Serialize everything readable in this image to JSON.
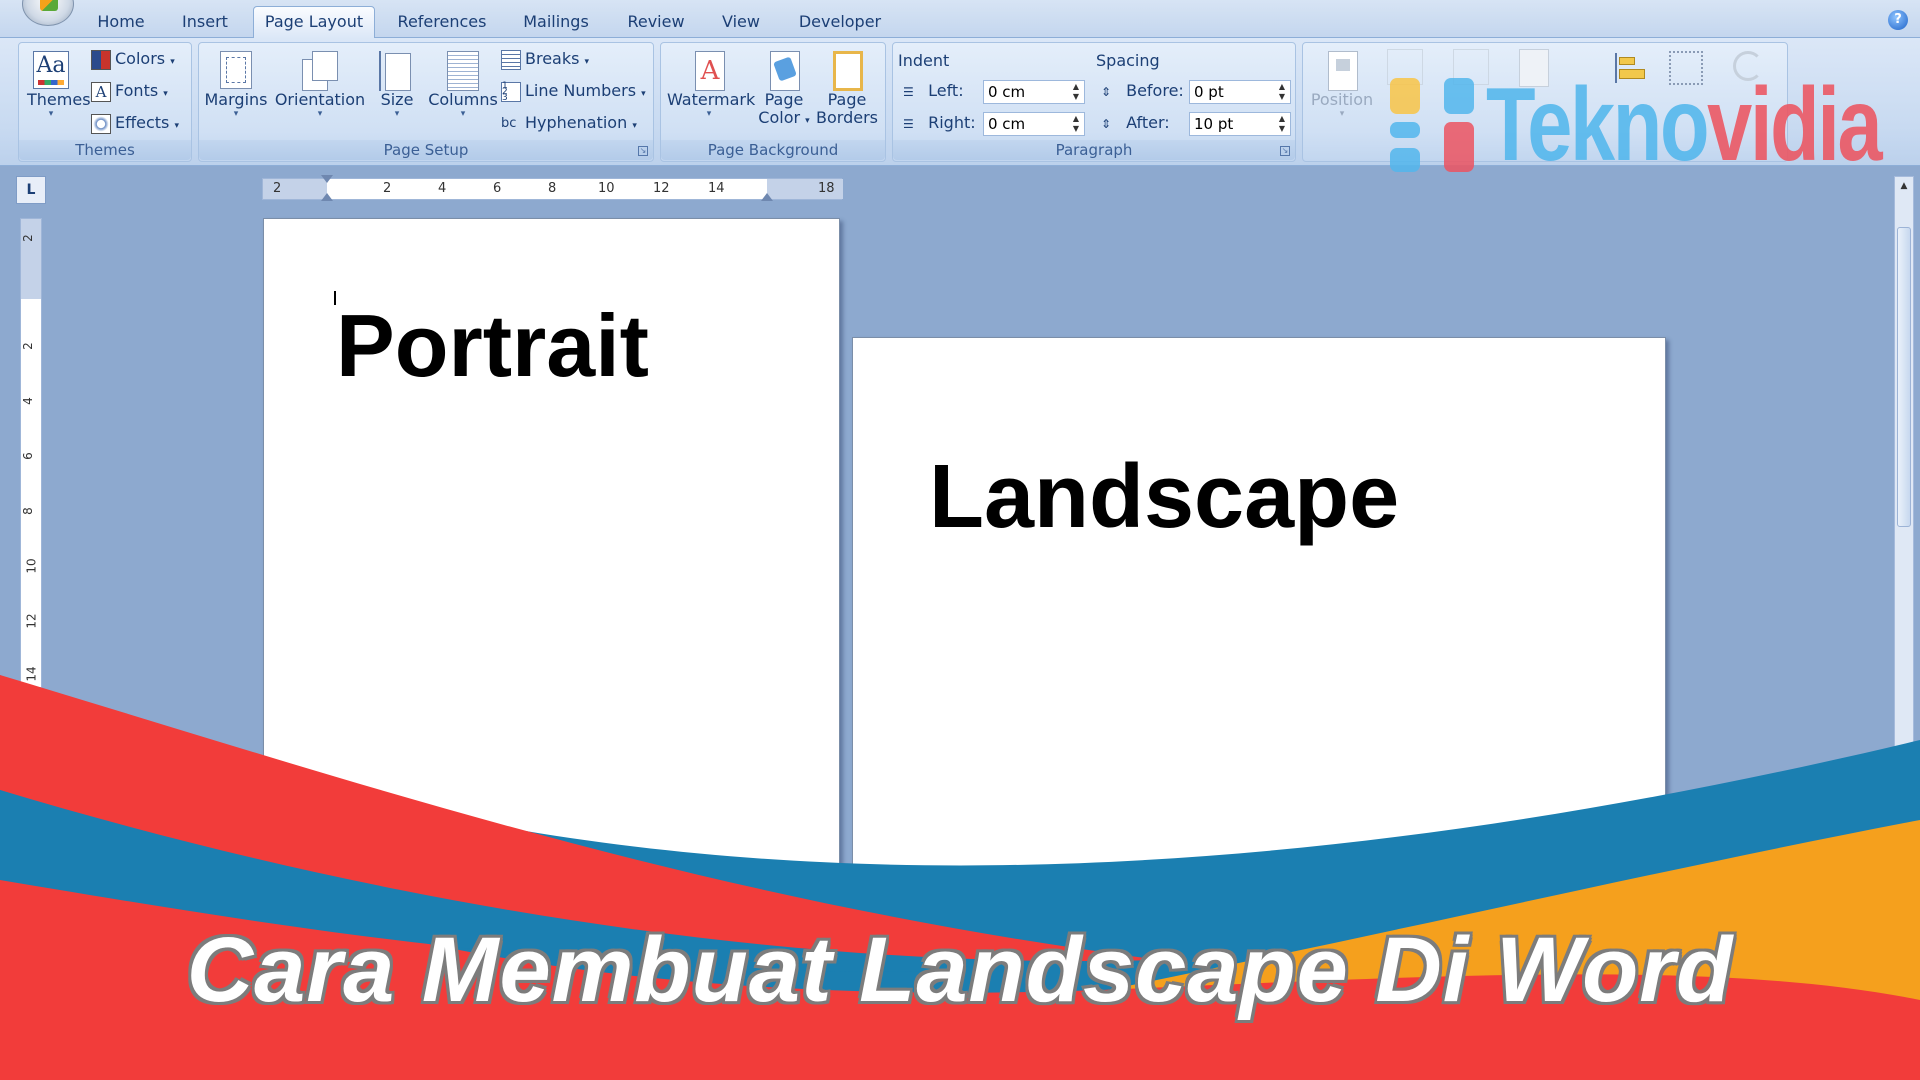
{
  "tabs": {
    "home": "Home",
    "insert": "Insert",
    "page_layout": "Page Layout",
    "references": "References",
    "mailings": "Mailings",
    "review": "Review",
    "view": "View",
    "developer": "Developer",
    "active": "Page Layout"
  },
  "ribbon": {
    "themes": {
      "group": "Themes",
      "themes": "Themes",
      "colors": "Colors",
      "fonts": "Fonts",
      "effects": "Effects"
    },
    "page_setup": {
      "group": "Page Setup",
      "margins": "Margins",
      "orientation": "Orientation",
      "size": "Size",
      "columns": "Columns",
      "breaks": "Breaks",
      "line_numbers": "Line Numbers",
      "hyphenation": "Hyphenation"
    },
    "page_background": {
      "group": "Page Background",
      "watermark": "Watermark",
      "page_color_1": "Page",
      "page_color_2": "Color",
      "page_borders_1": "Page",
      "page_borders_2": "Borders"
    },
    "paragraph": {
      "group": "Paragraph",
      "indent": "Indent",
      "left_label": "Left:",
      "left_value": "0 cm",
      "right_label": "Right:",
      "right_value": "0 cm",
      "spacing": "Spacing",
      "before_label": "Before:",
      "before_value": "0 pt",
      "after_label": "After:",
      "after_value": "10 pt"
    },
    "arrange": {
      "position": "Position"
    }
  },
  "ruler": {
    "horizontal": [
      "2",
      "2",
      "4",
      "6",
      "8",
      "10",
      "12",
      "14",
      "18"
    ],
    "vertical": [
      "2",
      "2",
      "4",
      "6",
      "8",
      "10",
      "12",
      "14"
    ],
    "corner": "L"
  },
  "document": {
    "portrait_text": "Portrait",
    "landscape_text": "Landscape"
  },
  "watermark": {
    "part1": "Tekno",
    "part2": "vidia"
  },
  "banner": {
    "title": "Cara Membuat Landscape Di Word",
    "colors": {
      "blue": "#1b7fb1",
      "red": "#f23c3a",
      "orange": "#f5a01d"
    }
  }
}
